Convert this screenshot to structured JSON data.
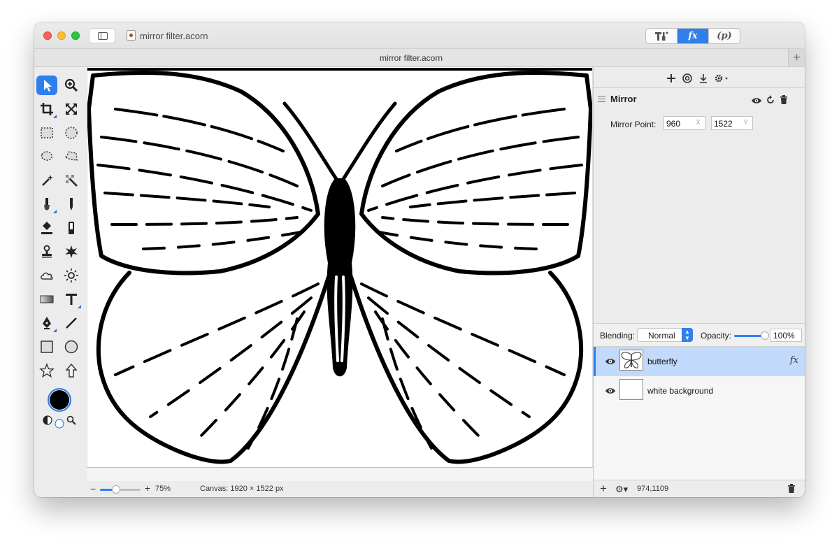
{
  "window": {
    "title": "mirror filter.acorn",
    "tab_title": "mirror filter.acorn",
    "tab_add": "+"
  },
  "toolbar_segments": [
    {
      "label": "",
      "icon": "tools-icon",
      "active": false
    },
    {
      "label": "fx",
      "icon": "fx-icon",
      "active": true
    },
    {
      "label": "(p)",
      "icon": "plugin-icon",
      "active": false
    }
  ],
  "tools": [
    {
      "name": "select",
      "icon": "arrow-pointer-icon",
      "selected": true
    },
    {
      "name": "zoom",
      "icon": "zoom-icon"
    },
    {
      "name": "crop",
      "icon": "crop-icon"
    },
    {
      "name": "transform",
      "icon": "transform-icon"
    },
    {
      "name": "rect-select",
      "icon": "rect-select-icon"
    },
    {
      "name": "ellipse-select",
      "icon": "ellipse-select-icon"
    },
    {
      "name": "lasso",
      "icon": "lasso-icon"
    },
    {
      "name": "polygon-lasso",
      "icon": "polygon-lasso-icon"
    },
    {
      "name": "magic-wand",
      "icon": "magic-wand-icon"
    },
    {
      "name": "instant-alpha",
      "icon": "instant-alpha-icon"
    },
    {
      "name": "brush",
      "icon": "brush-icon"
    },
    {
      "name": "pencil",
      "icon": "pencil-icon"
    },
    {
      "name": "paint-bucket",
      "icon": "paint-bucket-icon"
    },
    {
      "name": "eraser",
      "icon": "eraser-icon"
    },
    {
      "name": "clone",
      "icon": "clone-stamp-icon"
    },
    {
      "name": "burn",
      "icon": "burn-icon"
    },
    {
      "name": "blur",
      "icon": "cloud-icon"
    },
    {
      "name": "dodge",
      "icon": "sun-icon"
    },
    {
      "name": "gradient",
      "icon": "gradient-icon"
    },
    {
      "name": "text",
      "icon": "text-icon"
    },
    {
      "name": "pen",
      "icon": "pen-icon"
    },
    {
      "name": "line",
      "icon": "line-icon"
    },
    {
      "name": "rectangle",
      "icon": "rectangle-icon"
    },
    {
      "name": "oval",
      "icon": "oval-icon"
    },
    {
      "name": "star",
      "icon": "star-icon"
    },
    {
      "name": "arrow",
      "icon": "arrow-up-icon"
    }
  ],
  "colors": {
    "foreground": "#000000",
    "accent": "#2f80ed",
    "selection": "#c1d9fb"
  },
  "filter": {
    "name": "Mirror",
    "mirror_point_label": "Mirror Point:",
    "x_value": "960",
    "x_suffix": "X",
    "y_value": "1522",
    "y_suffix": "Y"
  },
  "blending": {
    "label": "Blending:",
    "mode": "Normal",
    "opacity_label": "Opacity:",
    "opacity_value": "100%",
    "opacity_fraction": 1.0
  },
  "layers": [
    {
      "name": "butterfly",
      "selected": true,
      "has_fx": true,
      "fx_label": "fx"
    },
    {
      "name": "white background",
      "selected": false,
      "has_fx": false
    }
  ],
  "layers_footer": {
    "plus": "+",
    "gear": "⚙▾",
    "coords": "974,1109"
  },
  "status": {
    "zoom_minus": "−",
    "zoom_plus": "+",
    "zoom_value": "75%",
    "zoom_fraction": 0.4,
    "canvas_info": "Canvas: 1920 × 1522 px"
  }
}
